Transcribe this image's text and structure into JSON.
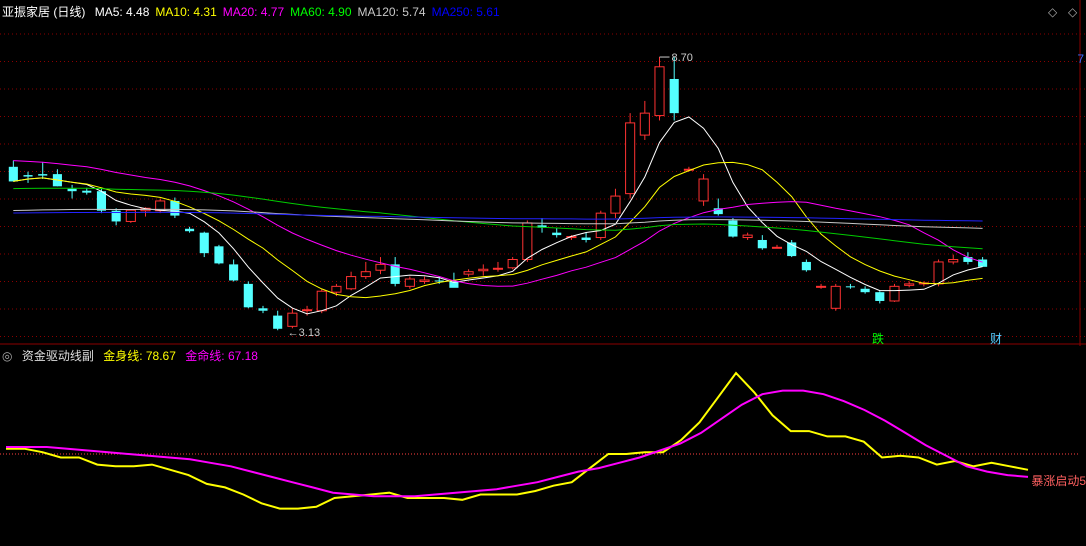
{
  "main_panel": {
    "stock_name": "亚振家居",
    "period": "(日线)",
    "ma_labels": [
      {
        "name": "MA5",
        "value": "4.48",
        "color": "#ffffff"
      },
      {
        "name": "MA10",
        "value": "4.31",
        "color": "#ffff00"
      },
      {
        "name": "MA20",
        "value": "4.77",
        "color": "#ff00ff"
      },
      {
        "name": "MA60",
        "value": "4.90",
        "color": "#00ff00"
      },
      {
        "name": "MA120",
        "value": "5.74",
        "color": "#c8c8c8"
      },
      {
        "name": "MA250",
        "value": "5.61",
        "color": "#0000ff"
      }
    ],
    "high_label": "8.70",
    "low_label": "3.13",
    "event_markers": [
      {
        "text": "跌",
        "index": 31,
        "color": "#00ff00"
      },
      {
        "text": "财",
        "index": 36,
        "color": "#55ccff"
      }
    ],
    "right_edge_glyph": "7"
  },
  "sub_panel": {
    "indicator_name": "资金驱动线副",
    "line1_name": "金身线",
    "line1_value": "78.67",
    "line1_color": "#ffff00",
    "line2_name": "金命线",
    "line2_value": "67.18",
    "line2_color": "#ff00ff",
    "threshold_label": "暴涨启动5",
    "threshold_color": "#ff6060"
  },
  "colors": {
    "up": "#ff3232",
    "down": "#54ffff",
    "grid": "#8b0000",
    "bg": "#000000"
  },
  "chart_data": [
    {
      "type": "candlestick",
      "title": "亚振家居 (日线)",
      "y_range": [
        2.9,
        9.5
      ],
      "categories_count": 38,
      "candles": [
        {
          "o": 6.45,
          "h": 6.58,
          "l": 6.2,
          "c": 6.15
        },
        {
          "o": 6.28,
          "h": 6.35,
          "l": 6.12,
          "c": 6.25
        },
        {
          "o": 6.3,
          "h": 6.55,
          "l": 6.2,
          "c": 6.27
        },
        {
          "o": 6.3,
          "h": 6.4,
          "l": 6.05,
          "c": 6.05
        },
        {
          "o": 6.0,
          "h": 6.08,
          "l": 5.8,
          "c": 5.95
        },
        {
          "o": 5.96,
          "h": 6.02,
          "l": 5.88,
          "c": 5.92
        },
        {
          "o": 5.95,
          "h": 6.02,
          "l": 5.5,
          "c": 5.55
        },
        {
          "o": 5.55,
          "h": 5.6,
          "l": 5.25,
          "c": 5.33
        },
        {
          "o": 5.33,
          "h": 5.58,
          "l": 5.3,
          "c": 5.56
        },
        {
          "o": 5.55,
          "h": 5.62,
          "l": 5.43,
          "c": 5.6
        },
        {
          "o": 5.55,
          "h": 5.8,
          "l": 5.5,
          "c": 5.75
        },
        {
          "o": 5.75,
          "h": 5.82,
          "l": 5.4,
          "c": 5.45
        },
        {
          "o": 5.18,
          "h": 5.22,
          "l": 5.1,
          "c": 5.13
        },
        {
          "o": 5.1,
          "h": 5.12,
          "l": 4.6,
          "c": 4.68
        },
        {
          "o": 4.82,
          "h": 4.85,
          "l": 4.45,
          "c": 4.47
        },
        {
          "o": 4.45,
          "h": 4.55,
          "l": 4.1,
          "c": 4.12
        },
        {
          "o": 4.05,
          "h": 4.1,
          "l": 3.55,
          "c": 3.57
        },
        {
          "o": 3.55,
          "h": 3.6,
          "l": 3.45,
          "c": 3.5
        },
        {
          "o": 3.4,
          "h": 3.5,
          "l": 3.1,
          "c": 3.13
        },
        {
          "o": 3.18,
          "h": 3.55,
          "l": 3.14,
          "c": 3.45
        },
        {
          "o": 3.5,
          "h": 3.6,
          "l": 3.4,
          "c": 3.52
        },
        {
          "o": 3.5,
          "h": 3.95,
          "l": 3.45,
          "c": 3.9
        },
        {
          "o": 3.88,
          "h": 4.05,
          "l": 3.8,
          "c": 4.0
        },
        {
          "o": 3.95,
          "h": 4.3,
          "l": 3.92,
          "c": 4.2
        },
        {
          "o": 4.2,
          "h": 4.5,
          "l": 4.15,
          "c": 4.3
        },
        {
          "o": 4.33,
          "h": 4.6,
          "l": 4.25,
          "c": 4.45
        },
        {
          "o": 4.45,
          "h": 4.6,
          "l": 4.0,
          "c": 4.05
        },
        {
          "o": 4.0,
          "h": 4.2,
          "l": 3.95,
          "c": 4.15
        },
        {
          "o": 4.1,
          "h": 4.2,
          "l": 4.05,
          "c": 4.13
        },
        {
          "o": 4.12,
          "h": 4.2,
          "l": 4.05,
          "c": 4.1
        },
        {
          "o": 4.1,
          "h": 4.28,
          "l": 4.0,
          "c": 3.97
        }
      ]
    },
    {
      "type": "line",
      "title": "资金驱动线副",
      "x_count": 46,
      "series": [
        {
          "name": "金身线",
          "values": [
            53,
            53,
            51,
            48,
            48,
            44,
            43,
            43,
            44,
            41,
            38,
            33,
            31,
            27,
            22,
            19,
            19,
            20,
            25,
            26,
            27,
            28,
            25,
            25,
            25,
            24,
            27,
            27,
            27,
            29,
            32,
            34,
            42,
            50,
            50,
            51,
            51,
            58,
            68,
            82,
            96,
            85,
            72,
            63,
            63,
            60,
            60,
            57,
            48,
            49,
            48,
            44,
            46,
            43,
            45,
            43,
            41
          ]
        },
        {
          "name": "金命线",
          "values": [
            54,
            54,
            54,
            53,
            52,
            51,
            50,
            49,
            48,
            47,
            45,
            43,
            40,
            37,
            34,
            31,
            28,
            27,
            26,
            26,
            26,
            27,
            28,
            29,
            30,
            32,
            34,
            37,
            40,
            42,
            45,
            48,
            52,
            56,
            62,
            70,
            78,
            84,
            86,
            86,
            84,
            80,
            75,
            69,
            62,
            55,
            49,
            43,
            40,
            38,
            37
          ]
        }
      ],
      "threshold": 50
    }
  ]
}
